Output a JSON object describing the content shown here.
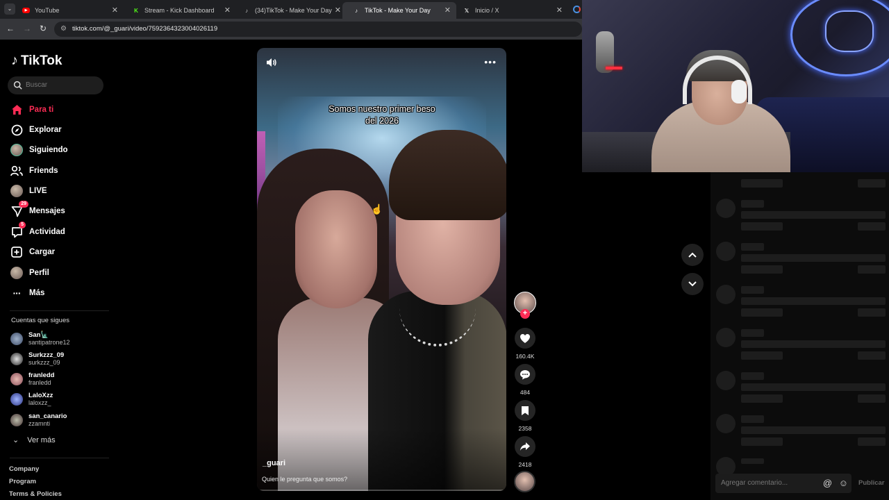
{
  "browser": {
    "tabs": [
      {
        "title": "YouTube",
        "icon": "youtube-icon",
        "active": false
      },
      {
        "title": "Stream - Kick Dashboard",
        "icon": "kick-icon",
        "active": false
      },
      {
        "title": "(34)TikTok - Make Your Day",
        "icon": "tiktok-icon",
        "active": false
      },
      {
        "title": "TikTok - Make Your Day",
        "icon": "tiktok-icon",
        "active": true
      },
      {
        "title": "Inicio / X",
        "icon": "x-icon",
        "active": false
      }
    ],
    "url": "tiktok.com/@_guari/video/7592364323004026119"
  },
  "sidebar": {
    "logo": "TikTok",
    "search_placeholder": "Buscar",
    "nav": [
      {
        "label": "Para ti",
        "icon": "home-icon",
        "active": true
      },
      {
        "label": "Explorar",
        "icon": "compass-icon"
      },
      {
        "label": "Siguiendo",
        "icon": "following-avatar-icon"
      },
      {
        "label": "Friends",
        "icon": "friends-icon"
      },
      {
        "label": "LIVE",
        "icon": "live-avatar-icon"
      },
      {
        "label": "Mensajes",
        "icon": "messages-icon",
        "badge": "29"
      },
      {
        "label": "Actividad",
        "icon": "activity-icon",
        "badge": "5"
      },
      {
        "label": "Cargar",
        "icon": "upload-icon"
      },
      {
        "label": "Perfil",
        "icon": "profile-avatar-icon"
      },
      {
        "label": "Más",
        "icon": "more-icon"
      }
    ],
    "following_title": "Cuentas que sigues",
    "accounts": [
      {
        "name": "San🗽",
        "handle": "santipatrone12"
      },
      {
        "name": "Surkzzz_09",
        "handle": "surkzzz_09"
      },
      {
        "name": "franledd",
        "handle": "franledd"
      },
      {
        "name": "LaloXzz",
        "handle": "laloxzz_"
      },
      {
        "name": "san_canario",
        "handle": "zzamnti"
      }
    ],
    "see_more": "Ver más",
    "footer": [
      "Company",
      "Program",
      "Terms & Policies"
    ]
  },
  "video": {
    "overlay_text_line1": "Somos nuestro primer beso",
    "overlay_text_line2": "del 2026",
    "author": "_guari",
    "caption": "Quien le pregunta que somos?",
    "progress": 0.0
  },
  "actions": {
    "likes": "160.4K",
    "comments": "484",
    "saves": "2358",
    "shares": "2418"
  },
  "comments_panel": {
    "input_placeholder": "Agregar comentario...",
    "publish_label": "Publicar"
  },
  "colors": {
    "accent": "#fe2c55",
    "background": "#000000"
  }
}
